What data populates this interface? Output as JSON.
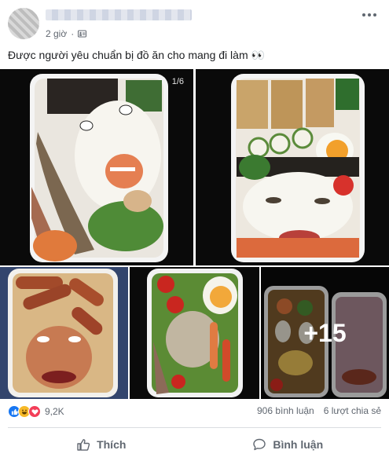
{
  "post": {
    "time": "2 giờ",
    "caption": "Được người yêu chuẩn bị đồ ăn cho mang đi làm 👀",
    "photo_counter": "1/6",
    "more_photos": "+15",
    "reaction_count": "9,2K",
    "comments": "906 bình luận",
    "shares": "6 lượt chia sẻ"
  },
  "actions": {
    "like_label": "Thích",
    "comment_label": "Bình luận"
  },
  "icons": {
    "privacy": "friends-icon",
    "reactions": [
      "like-icon",
      "haha-icon",
      "love-icon"
    ]
  },
  "colors": {
    "facebook_blue": "#1877f2",
    "text_secondary": "#606770"
  }
}
